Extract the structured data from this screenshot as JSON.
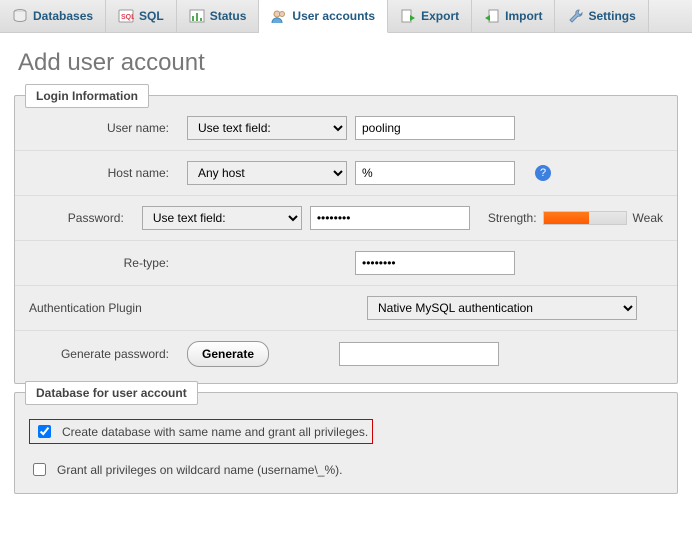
{
  "tabs": {
    "databases": "Databases",
    "sql": "SQL",
    "status": "Status",
    "user_accounts": "User accounts",
    "export": "Export",
    "import": "Import",
    "settings": "Settings"
  },
  "page_title": "Add user account",
  "login_info": {
    "legend": "Login Information",
    "user_name_label": "User name:",
    "user_name_mode": "Use text field:",
    "user_name_value": "pooling",
    "host_name_label": "Host name:",
    "host_name_mode": "Any host",
    "host_name_value": "%",
    "password_label": "Password:",
    "password_mode": "Use text field:",
    "password_value": "••••••••",
    "strength_label": "Strength:",
    "strength_text": "Weak",
    "retype_label": "Re-type:",
    "retype_value": "••••••••",
    "auth_plugin_label": "Authentication Plugin",
    "auth_plugin_value": "Native MySQL authentication",
    "generate_label": "Generate password:",
    "generate_button": "Generate"
  },
  "db_section": {
    "legend": "Database for user account",
    "create_same": "Create database with same name and grant all privileges.",
    "grant_wildcard": "Grant all privileges on wildcard name (username\\_%)."
  }
}
